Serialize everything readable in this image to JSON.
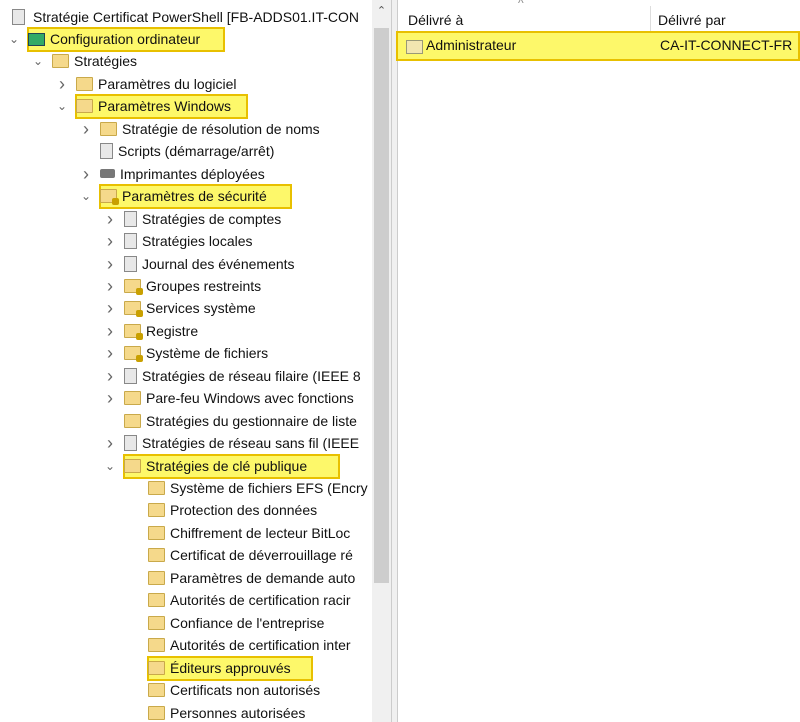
{
  "tree": {
    "root": "Stratégie Certificat PowerShell [FB-ADDS01.IT-CON",
    "items": [
      {
        "label": "Configuration ordinateur",
        "level": 0,
        "chevron": "down",
        "icon": "computer",
        "highlight": true
      },
      {
        "label": "Stratégies",
        "level": 1,
        "chevron": "down",
        "icon": "folder"
      },
      {
        "label": "Paramètres du logiciel",
        "level": 2,
        "chevron": "right",
        "icon": "folder"
      },
      {
        "label": "Paramètres Windows",
        "level": 2,
        "chevron": "down",
        "icon": "folder",
        "highlight": true
      },
      {
        "label": "Stratégie de résolution de noms",
        "level": 3,
        "chevron": "right",
        "icon": "folder"
      },
      {
        "label": "Scripts (démarrage/arrêt)",
        "level": 3,
        "chevron": "",
        "icon": "doc"
      },
      {
        "label": "Imprimantes déployées",
        "level": 3,
        "chevron": "right",
        "icon": "printer"
      },
      {
        "label": "Paramètres de sécurité",
        "level": 3,
        "chevron": "down",
        "icon": "lock",
        "highlight": true
      },
      {
        "label": "Stratégies de comptes",
        "level": 4,
        "chevron": "right",
        "icon": "doc"
      },
      {
        "label": "Stratégies locales",
        "level": 4,
        "chevron": "right",
        "icon": "doc"
      },
      {
        "label": "Journal des événements",
        "level": 4,
        "chevron": "right",
        "icon": "doc"
      },
      {
        "label": "Groupes restreints",
        "level": 4,
        "chevron": "right",
        "icon": "lock"
      },
      {
        "label": "Services système",
        "level": 4,
        "chevron": "right",
        "icon": "lock"
      },
      {
        "label": "Registre",
        "level": 4,
        "chevron": "right",
        "icon": "lock"
      },
      {
        "label": "Système de fichiers",
        "level": 4,
        "chevron": "right",
        "icon": "lock"
      },
      {
        "label": "Stratégies de réseau filaire (IEEE 8",
        "level": 4,
        "chevron": "right",
        "icon": "doc"
      },
      {
        "label": "Pare-feu Windows avec fonctions",
        "level": 4,
        "chevron": "right",
        "icon": "folder"
      },
      {
        "label": "Stratégies du gestionnaire de liste",
        "level": 4,
        "chevron": "",
        "icon": "folder"
      },
      {
        "label": "Stratégies de réseau sans fil (IEEE",
        "level": 4,
        "chevron": "right",
        "icon": "doc"
      },
      {
        "label": "Stratégies de clé publique",
        "level": 4,
        "chevron": "down",
        "icon": "folder",
        "highlight": true
      },
      {
        "label": "Système de fichiers EFS (Encry",
        "level": 5,
        "chevron": "",
        "icon": "folder"
      },
      {
        "label": "Protection des données",
        "level": 5,
        "chevron": "",
        "icon": "folder"
      },
      {
        "label": "Chiffrement de lecteur BitLoc",
        "level": 5,
        "chevron": "",
        "icon": "folder"
      },
      {
        "label": "Certificat de déverrouillage ré",
        "level": 5,
        "chevron": "",
        "icon": "folder"
      },
      {
        "label": "Paramètres de demande auto",
        "level": 5,
        "chevron": "",
        "icon": "folder"
      },
      {
        "label": "Autorités de certification racir",
        "level": 5,
        "chevron": "",
        "icon": "folder"
      },
      {
        "label": "Confiance de l'entreprise",
        "level": 5,
        "chevron": "",
        "icon": "folder"
      },
      {
        "label": "Autorités de certification inter",
        "level": 5,
        "chevron": "",
        "icon": "folder"
      },
      {
        "label": "Éditeurs approuvés",
        "level": 5,
        "chevron": "",
        "icon": "folder",
        "highlight": true
      },
      {
        "label": "Certificats non autorisés",
        "level": 5,
        "chevron": "",
        "icon": "folder"
      },
      {
        "label": "Personnes autorisées",
        "level": 5,
        "chevron": "",
        "icon": "folder"
      }
    ]
  },
  "list": {
    "columns": [
      "Délivré à",
      "Délivré par"
    ],
    "rows": [
      {
        "issued_to": "Administrateur",
        "issued_by": "CA-IT-CONNECT-FR"
      }
    ]
  }
}
